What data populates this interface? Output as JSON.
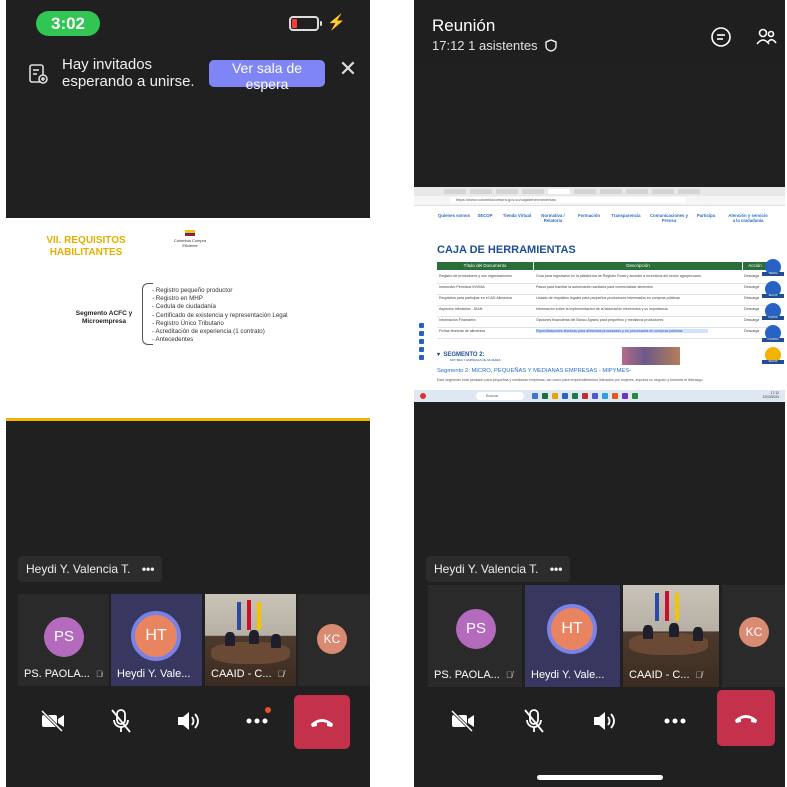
{
  "left": {
    "status": {
      "time": "3:02"
    },
    "banner": {
      "message": "Hay invitados esperando a unirse.",
      "button": "Ver sala de espera"
    },
    "slide": {
      "title": "VII. REQUISITOS HABILITANTES",
      "logo_text": "Colombia Compra Eficiente",
      "segment": "Segmento ACFC y Microempresa",
      "items": [
        "Registro pequeño productor",
        "Registro en MHP",
        "Cedula de ciudadanía",
        "Certificado de existencia y representación Legal",
        "Registro Único Tributario",
        "Acreditación de experiencia (1 contrato)",
        "Antecedentes"
      ]
    },
    "speaker": {
      "name": "Heydi Y. Valencia T.",
      "more": "•••"
    },
    "tiles": [
      {
        "initials": "PS",
        "label": "PS. PAOLA..."
      },
      {
        "initials": "HT",
        "label": "Heydi Y. Vale..."
      },
      {
        "label": "CAAID - C..."
      },
      {
        "initials": "KC"
      }
    ]
  },
  "right": {
    "header": {
      "title": "Reunión",
      "time": "17:12",
      "attendees": "1 asistentes"
    },
    "screen": {
      "url": "https://www.colombiacompra.gov.co/cajadeherramientas",
      "nav": [
        "Quienes somos",
        "SECOP",
        "Tienda Virtual",
        "Normativa / Relatoria",
        "Formación",
        "Transparencia",
        "Comunicaciones y Prensa",
        "Participa",
        "Atención y servicio a la ciudadanía"
      ],
      "heading": "CAJA DE HERRAMIENTAS",
      "columns": [
        "Título del Documento",
        "Descripción",
        "Acción"
      ],
      "rows": [
        [
          "Registro de productores y sus organizaciones",
          "Guía para registrarse en la plataforma de Registro Rural y acceder a incentivos del sector agropecuario.",
          "Descarga"
        ],
        [
          "Instructivo Permisos INVIMA",
          "Pasos para tramitar la autorización sanitaria para comercializar alimentos",
          "Descarga"
        ],
        [
          "Requisitos para participar en el IAD Alimentos",
          "Listado de requisitos legales para pequeños productores interesados en compras públicas",
          "Descarga"
        ],
        [
          "Aspectos tributarios - DIAN",
          "Información sobre la implementación de la facturación electrónica y su importancia",
          "Descarga"
        ],
        [
          "Información Financiera",
          "Opciones financieras del Banco Agrario para pequeños y medianos productores",
          "Descarga"
        ],
        [
          "Fichas técnicas de alimentos",
          "Especificaciones técnicas para alimentos procesados y no procesados en compras públicas",
          "Descarga"
        ]
      ],
      "side_labels": [
        "TIENDA",
        "SECOP",
        "PQRSD",
        "COMPRA PÚBLICA",
        "SECOP"
      ],
      "segment2_title": "SEGMENTO 2:",
      "segment2_sub": "MIPYMES Y EMPRESAS DE MUJERES",
      "segment2_line": "Segmento 2: MICRO, PEQUEÑAS Y MEDIANAS EMPRESAS - MIPYMES-",
      "segment2_text": "Este segmento está pensado para pequeñas y medianas empresas, así como para emprendimientos liderados por mujeres, impulsa su negocio y fomenta el liderazgo",
      "taskbar_search": "Buscar",
      "clock": "17:12",
      "date": "12/03/2024"
    },
    "speaker": {
      "name": "Heydi Y. Valencia T.",
      "more": "•••"
    },
    "tiles": [
      {
        "initials": "PS",
        "label": "PS. PAOLA..."
      },
      {
        "initials": "HT",
        "label": "Heydi Y. Vale..."
      },
      {
        "label": "CAAID - C..."
      },
      {
        "initials": "KC"
      }
    ]
  },
  "colors": {
    "brand": "#7f85f5",
    "hangup": "#c4314b",
    "status_pill": "#31c553",
    "slide_title": "#e0b000"
  },
  "icons": [
    "waiting-room-icon",
    "close-icon",
    "chat-icon",
    "people-icon",
    "shield-icon",
    "camera-off-icon",
    "mic-off-icon",
    "speaker-icon",
    "more-icon",
    "hangup-icon"
  ]
}
